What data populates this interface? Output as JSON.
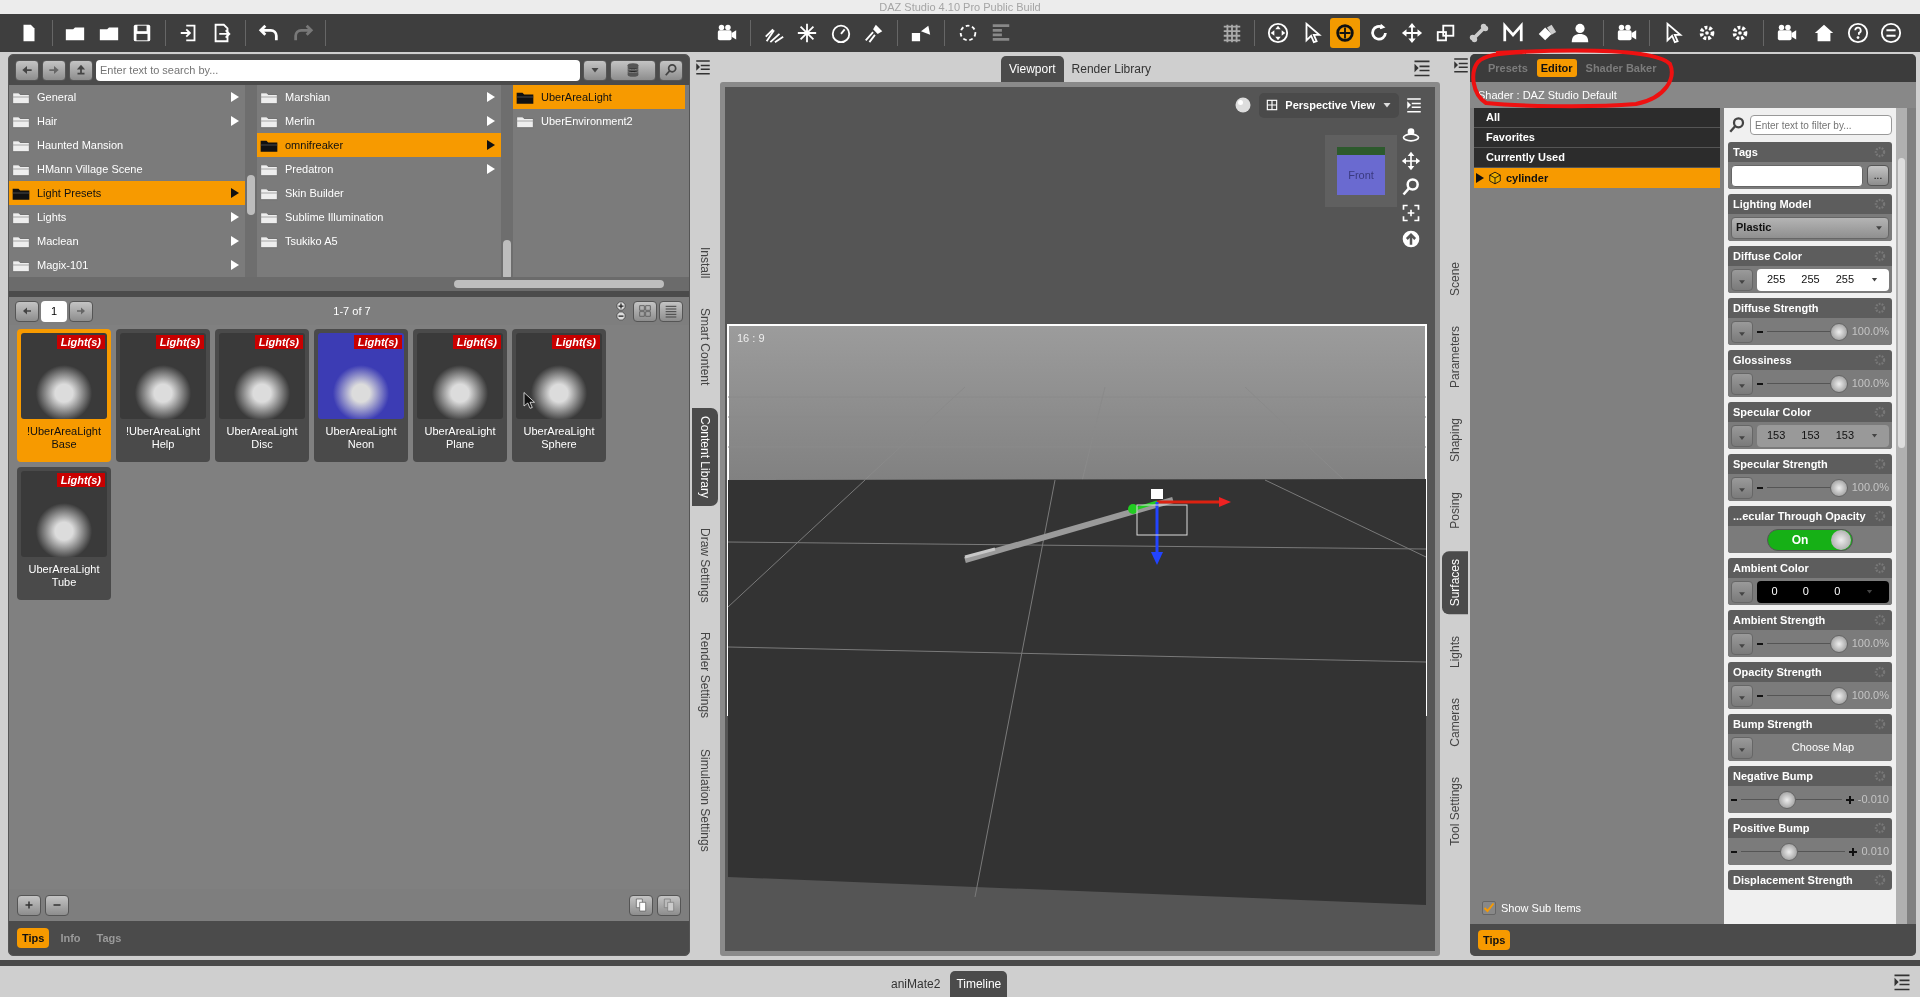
{
  "window": {
    "title": "DAZ Studio 4.10 Pro Public Build"
  },
  "toolbar": {
    "file_tools": [
      {
        "disabled": false
      },
      {
        "disabled": false
      },
      {
        "disabled": false
      },
      {
        "disabled": false
      },
      {
        "disabled": false
      },
      {
        "disabled": false
      },
      {
        "disabled": false
      },
      {
        "disabled": true
      }
    ],
    "scene_tools": [
      {
        "selected": false
      },
      {
        "selected": false
      },
      {
        "selected": false
      },
      {
        "selected": true
      },
      {
        "selected": false
      },
      {
        "selected": false
      },
      {
        "selected": false
      },
      {
        "selected": false
      },
      {
        "selected": false
      },
      {
        "selected": false
      },
      {
        "selected": false
      },
      {
        "selected": false
      },
      {
        "selected": false
      },
      {
        "selected": false
      },
      {
        "selected": false
      },
      {
        "selected": false
      }
    ]
  },
  "content_library": {
    "search": {
      "placeholder": "Enter text to search by..."
    },
    "columns": [
      {
        "items": [
          {
            "label": "General",
            "selected": false,
            "has_children": true
          },
          {
            "label": "Hair",
            "selected": false,
            "has_children": true
          },
          {
            "label": "Haunted Mansion",
            "selected": false,
            "has_children": false
          },
          {
            "label": "HMann Village Scene",
            "selected": false,
            "has_children": false
          },
          {
            "label": "Light Presets",
            "selected": true,
            "has_children": true
          },
          {
            "label": "Lights",
            "selected": false,
            "has_children": true
          },
          {
            "label": "Maclean",
            "selected": false,
            "has_children": true
          },
          {
            "label": "Magix-101",
            "selected": false,
            "has_children": true
          }
        ]
      },
      {
        "items": [
          {
            "label": "Marshian",
            "selected": false,
            "has_children": true
          },
          {
            "label": "Merlin",
            "selected": false,
            "has_children": true
          },
          {
            "label": "omnifreaker",
            "selected": true,
            "has_children": true
          },
          {
            "label": "Predatron",
            "selected": false,
            "has_children": true
          },
          {
            "label": "Skin Builder",
            "selected": false,
            "has_children": false
          },
          {
            "label": "Sublime Illumination",
            "selected": false,
            "has_children": false
          },
          {
            "label": "Tsukiko A5",
            "selected": false,
            "has_children": false
          }
        ]
      },
      {
        "items": [
          {
            "label": "UberAreaLight",
            "selected": true,
            "has_children": false
          },
          {
            "label": "UberEnvironment2",
            "selected": false,
            "has_children": false
          }
        ]
      }
    ],
    "page": "1",
    "count": "1-7 of 7",
    "presets": [
      {
        "name": "!UberAreaLight Base",
        "badge": "Light(s)",
        "selected": true,
        "color": "#3a3a3a"
      },
      {
        "name": "!UberAreaLight Help",
        "badge": "Light(s)",
        "selected": false,
        "color": "#3a3a3a"
      },
      {
        "name": "UberAreaLight Disc",
        "badge": "Light(s)",
        "selected": false,
        "color": "#3a3a3a"
      },
      {
        "name": "UberAreaLight Neon",
        "badge": "Light(s)",
        "selected": false,
        "color": "#3c3cb4"
      },
      {
        "name": "UberAreaLight Plane",
        "badge": "Light(s)",
        "selected": false,
        "color": "#3a3a3a"
      },
      {
        "name": "UberAreaLight Sphere",
        "badge": "Light(s)",
        "selected": false,
        "color": "#3a3a3a"
      },
      {
        "name": "UberAreaLight Tube",
        "badge": "Light(s)",
        "selected": false,
        "color": "#3a3a3a"
      }
    ],
    "bottom_tabs": [
      {
        "label": "Tips",
        "selected": true
      },
      {
        "label": "Info",
        "selected": false
      },
      {
        "label": "Tags",
        "selected": false
      }
    ]
  },
  "left_side_tabs": [
    {
      "label": "Install",
      "selected": false
    },
    {
      "label": "Smart Content",
      "selected": false
    },
    {
      "label": "Content Library",
      "selected": true
    },
    {
      "label": "Draw Settings",
      "selected": false
    },
    {
      "label": "Render Settings",
      "selected": false
    },
    {
      "label": "Simulation Settings",
      "selected": false
    }
  ],
  "viewport": {
    "tabs": [
      {
        "label": "Viewport",
        "selected": true
      },
      {
        "label": "Render Library",
        "selected": false
      }
    ],
    "view": "Perspective View",
    "cube_label": "Front",
    "aspect": "16 : 9"
  },
  "right_side_tabs": [
    {
      "label": "Scene",
      "selected": false
    },
    {
      "label": "Parameters",
      "selected": false
    },
    {
      "label": "Shaping",
      "selected": false
    },
    {
      "label": "Posing",
      "selected": false
    },
    {
      "label": "Surfaces",
      "selected": true
    },
    {
      "label": "Lights",
      "selected": false
    },
    {
      "label": "Cameras",
      "selected": false
    },
    {
      "label": "Tool Settings",
      "selected": false
    }
  ],
  "surfaces": {
    "tabs": [
      {
        "label": "Presets",
        "selected": false
      },
      {
        "label": "Editor",
        "selected": true
      },
      {
        "label": "Shader Baker",
        "selected": false
      }
    ],
    "shader": "Shader : DAZ Studio Default",
    "groups": [
      {
        "label": "All",
        "selected": false
      },
      {
        "label": "Favorites",
        "selected": false
      },
      {
        "label": "Currently Used",
        "selected": false
      }
    ],
    "tree": [
      {
        "label": "cylinder",
        "selected": true,
        "expanded": false
      }
    ],
    "show_sub_items": {
      "label": "Show Sub Items",
      "checked": true
    },
    "filter": {
      "placeholder": "Enter text to filter by..."
    },
    "properties": [
      {
        "kind": "text",
        "label": "Tags",
        "button": "..."
      },
      {
        "kind": "dropdown",
        "label": "Lighting Model",
        "value": "Plastic"
      },
      {
        "kind": "color",
        "label": "Diffuse Color",
        "values": [
          "255",
          "255",
          "255"
        ],
        "color": "#ffffff"
      },
      {
        "kind": "slider",
        "label": "Diffuse Strength",
        "level": 1,
        "reading": "100.0%"
      },
      {
        "kind": "slider",
        "label": "Glossiness",
        "level": 1,
        "reading": "100.0%"
      },
      {
        "kind": "color",
        "label": "Specular Color",
        "values": [
          "153",
          "153",
          "153"
        ],
        "color": "#999999"
      },
      {
        "kind": "slider",
        "label": "Specular Strength",
        "level": 1,
        "reading": "100.0%"
      },
      {
        "kind": "switch",
        "label": "...ecular Through Opacity",
        "on": true,
        "value": "On"
      },
      {
        "kind": "color",
        "label": "Ambient Color",
        "values": [
          "0",
          "0",
          "0"
        ],
        "color": "#000000"
      },
      {
        "kind": "slider",
        "label": "Ambient Strength",
        "level": 1,
        "reading": "100.0%"
      },
      {
        "kind": "slider",
        "label": "Opacity Strength",
        "level": 1,
        "reading": "100.0%"
      },
      {
        "kind": "map",
        "label": "Bump Strength",
        "value": "Choose Map"
      },
      {
        "kind": "bipolar",
        "label": "Negative Bump",
        "level": 0.45,
        "reading": "-0.010"
      },
      {
        "kind": "bipolar",
        "label": "Positive Bump",
        "level": 0.45,
        "reading": "0.010"
      },
      {
        "kind": "header",
        "label": "Displacement Strength"
      }
    ],
    "bottom_tabs": [
      {
        "label": "Tips",
        "selected": true
      }
    ]
  },
  "dock_tabs": [
    {
      "label": "aniMate2",
      "selected": false
    },
    {
      "label": "Timeline",
      "selected": true
    }
  ]
}
